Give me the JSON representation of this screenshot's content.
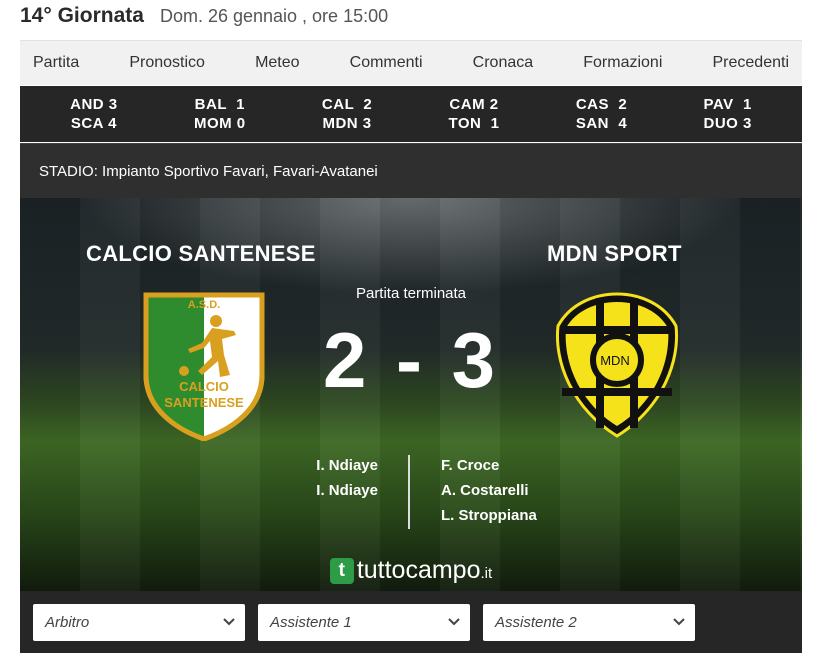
{
  "header": {
    "round": "14° Giornata",
    "date": "Dom. 26 gennaio , ore 15:00"
  },
  "tabs": [
    "Partita",
    "Pronostico",
    "Meteo",
    "Commenti",
    "Cronaca",
    "Formazioni",
    "Precedenti"
  ],
  "other_results": [
    {
      "home": "AND 3",
      "away": "SCA 4"
    },
    {
      "home": "BAL  1",
      "away": "MOM 0"
    },
    {
      "home": "CAL  2",
      "away": "MDN 3"
    },
    {
      "home": "CAM 2",
      "away": "TON  1"
    },
    {
      "home": "CAS  2",
      "away": "SAN  4"
    },
    {
      "home": "PAV  1",
      "away": "DUO 3"
    }
  ],
  "stadium": "STADIO: Impianto Sportivo Favari, Favari-Avatanei",
  "match": {
    "home_team": "CALCIO SANTENESE",
    "away_team": "MDN SPORT",
    "status": "Partita terminata",
    "score": "2 - 3",
    "home_scorers": [
      "I. Ndiaye",
      "I. Ndiaye"
    ],
    "away_scorers": [
      "F. Croce",
      "A. Costarelli",
      "L. Stroppiana"
    ],
    "home_logo": {
      "top": "A.S.D.",
      "line1": "CALCIO",
      "line2": "SANTENESE",
      "icon": "shield-logo-icon",
      "colors": [
        "#2e8b2e",
        "#ffffff",
        "#d9a020"
      ]
    },
    "away_logo": {
      "text": "MDN",
      "icon": "shield-logo-icon",
      "colors": [
        "#f5e21b",
        "#111111"
      ]
    }
  },
  "brand": {
    "badge": "t",
    "name": "tuttocampo",
    "tld": ".it"
  },
  "officials": [
    {
      "label": "Arbitro",
      "icon": "chevron-down-icon"
    },
    {
      "label": "Assistente 1",
      "icon": "chevron-down-icon"
    },
    {
      "label": "Assistente 2",
      "icon": "chevron-down-icon"
    }
  ]
}
